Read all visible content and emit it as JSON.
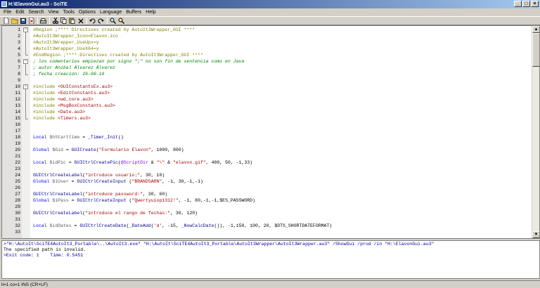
{
  "window": {
    "title": "H:\\ElavonGui.au3 - SciTE",
    "min_label": "_",
    "max_label": "□",
    "close_label": "×"
  },
  "menu": [
    "File",
    "Edit",
    "Search",
    "View",
    "Tools",
    "Options",
    "Language",
    "Buffers",
    "Help"
  ],
  "toolbar_icons": [
    "new-file-icon",
    "open-file-icon",
    "save-icon",
    "close-file-icon",
    "print-icon",
    "cut-icon",
    "copy-icon",
    "paste-icon",
    "delete-icon",
    "undo-icon",
    "redo-icon",
    "find-icon",
    "replace-icon"
  ],
  "editor": {
    "line_numbers": [
      "1",
      "2",
      "3",
      "4",
      "5",
      "6",
      "7",
      "8",
      "9",
      "10",
      "11",
      "12",
      "13",
      "14",
      "15",
      "16",
      "17",
      "18",
      "19",
      "20",
      "21",
      "22",
      "23",
      "24",
      "25",
      "26",
      "27",
      "28",
      "29",
      "30",
      "31",
      "32",
      "33"
    ],
    "code_lines": [
      [
        {
          "c": "t-pre",
          "t": "#Region ;**** Directives created by AutoIt3Wrapper_GUI ****"
        }
      ],
      [
        {
          "c": "t-pre",
          "t": "#AutoIt3Wrapper_Icon=Elavon.ico"
        }
      ],
      [
        {
          "c": "t-pre",
          "t": "#AutoIt3Wrapper_UseUpx=y"
        }
      ],
      [
        {
          "c": "t-pre",
          "t": "#AutoIt3Wrapper_UseX64=y"
        }
      ],
      [
        {
          "c": "t-pre",
          "t": "#EndRegion ;**** Directives created by AutoIt3Wrapper_GUI ****"
        }
      ],
      [
        {
          "c": "t-cmt",
          "t": "; los comentarios empiezan por signo \";\" no son fin de sentencia como en Java"
        }
      ],
      [
        {
          "c": "t-cmt",
          "t": "; autor Aníbal Álvarez Álvarez"
        }
      ],
      [
        {
          "c": "t-cmt",
          "t": "; fecha creación: 26-08-18"
        }
      ],
      [],
      [
        {
          "c": "t-pre",
          "t": "#include "
        },
        {
          "c": "t-inc",
          "t": "<GUIConstantsEx.au3>"
        }
      ],
      [
        {
          "c": "t-pre",
          "t": "#include "
        },
        {
          "c": "t-inc",
          "t": "<EditConstants.au3>"
        }
      ],
      [
        {
          "c": "t-pre",
          "t": "#include "
        },
        {
          "c": "t-inc",
          "t": "<wd_core.au3>"
        }
      ],
      [
        {
          "c": "t-pre",
          "t": "#include "
        },
        {
          "c": "t-inc",
          "t": "<MsgBoxConstants.au3>"
        }
      ],
      [
        {
          "c": "t-pre",
          "t": "#include "
        },
        {
          "c": "t-inc",
          "t": "<Date.au3>"
        }
      ],
      [
        {
          "c": "t-pre",
          "t": "#include "
        },
        {
          "c": "t-inc",
          "t": "<Timers.au3>"
        }
      ],
      [],
      [],
      [
        {
          "c": "t-kw",
          "t": "Local "
        },
        {
          "c": "t-var",
          "t": "$hStarttime"
        },
        {
          "c": "t-def",
          "t": " = "
        },
        {
          "c": "t-fn",
          "t": "_Timer_Init"
        },
        {
          "c": "t-def",
          "t": "()"
        }
      ],
      [],
      [
        {
          "c": "t-kw",
          "t": "Global "
        },
        {
          "c": "t-var",
          "t": "$Gid"
        },
        {
          "c": "t-def",
          "t": " = "
        },
        {
          "c": "t-fn",
          "t": "GUICreate"
        },
        {
          "c": "t-def",
          "t": "("
        },
        {
          "c": "t-str",
          "t": "\"Formulario Elavon\""
        },
        {
          "c": "t-def",
          "t": ", 1000, 800)"
        }
      ],
      [],
      [
        {
          "c": "t-kw",
          "t": "Local "
        },
        {
          "c": "t-var",
          "t": "$idPic"
        },
        {
          "c": "t-def",
          "t": " = "
        },
        {
          "c": "t-fn",
          "t": "GUICtrlCreatePic"
        },
        {
          "c": "t-def",
          "t": "("
        },
        {
          "c": "t-macro",
          "t": "@ScriptDir"
        },
        {
          "c": "t-def",
          "t": " & "
        },
        {
          "c": "t-str",
          "t": "\"\\\""
        },
        {
          "c": "t-def",
          "t": " & "
        },
        {
          "c": "t-str",
          "t": "\"elavon.gif\""
        },
        {
          "c": "t-def",
          "t": ", 400, 50, -1,33)"
        }
      ],
      [],
      [
        {
          "c": "t-fn",
          "t": "GUICtrlCreateLabel"
        },
        {
          "c": "t-def",
          "t": "("
        },
        {
          "c": "t-str",
          "t": "\"introduce usuario:\""
        },
        {
          "c": "t-def",
          "t": ", 30, 10)"
        }
      ],
      [
        {
          "c": "t-kw",
          "t": "Global "
        },
        {
          "c": "t-var",
          "t": "$iUser"
        },
        {
          "c": "t-def",
          "t": " = "
        },
        {
          "c": "t-fn",
          "t": "GUICtrlCreateInput"
        },
        {
          "c": "t-def",
          "t": " ("
        },
        {
          "c": "t-str",
          "t": "\"BRANDSARN\""
        },
        {
          "c": "t-def",
          "t": ", -1, 30,-1,-1)"
        }
      ],
      [],
      [
        {
          "c": "t-fn",
          "t": "GUICtrlCreateLabel"
        },
        {
          "c": "t-def",
          "t": "("
        },
        {
          "c": "t-str",
          "t": "\"introduce password:\""
        },
        {
          "c": "t-def",
          "t": ", 30, 60)"
        }
      ],
      [
        {
          "c": "t-kw",
          "t": "Global "
        },
        {
          "c": "t-var",
          "t": "$iPass"
        },
        {
          "c": "t-def",
          "t": " = "
        },
        {
          "c": "t-fn",
          "t": "GUICtrlCreateInput"
        },
        {
          "c": "t-def",
          "t": " ("
        },
        {
          "c": "t-str",
          "t": "\"Qwertyuiop1312!\""
        },
        {
          "c": "t-def",
          "t": ", -1, 80,-1,-1,$ES_PASSWORD)"
        }
      ],
      [],
      [
        {
          "c": "t-fn",
          "t": "GUICtrlCreateLabel"
        },
        {
          "c": "t-def",
          "t": "("
        },
        {
          "c": "t-str",
          "t": "\"introduce el rango de fechas:\""
        },
        {
          "c": "t-def",
          "t": ", 30, 120)"
        }
      ],
      [],
      [
        {
          "c": "t-kw",
          "t": "Local "
        },
        {
          "c": "t-var",
          "t": "$idDates"
        },
        {
          "c": "t-def",
          "t": " = "
        },
        {
          "c": "t-fn",
          "t": "GUICtrlCreateDate"
        },
        {
          "c": "t-def",
          "t": "("
        },
        {
          "c": "t-fn",
          "t": "_DateAdd"
        },
        {
          "c": "t-def",
          "t": "("
        },
        {
          "c": "t-str",
          "t": "'d'"
        },
        {
          "c": "t-def",
          "t": ", -15, "
        },
        {
          "c": "t-fn",
          "t": "_NowCalcDate"
        },
        {
          "c": "t-def",
          "t": "()), -1,150, 100, 20, $DTS_SHORTDATEFORMAT)"
        }
      ],
      []
    ]
  },
  "output": {
    "cmd_line": ">\"H:\\AutoIt\\SciTE4AutoIt3_Portable\\..\\AutoIt3.exe\" \"H:\\AutoIt\\SciTE4AutoIt3_Portable\\AutoIt3Wrapper\\AutoIt3Wrapper.au3\" /ShowGui /prod /in \"H:\\ElavonGui.au3\"",
    "error_line": "The specified path is invalid.",
    "exit_line": ">Exit code: 1    Time: 0.5451"
  },
  "status": {
    "text": "li=1 co=1 INS (CR+LF)"
  }
}
